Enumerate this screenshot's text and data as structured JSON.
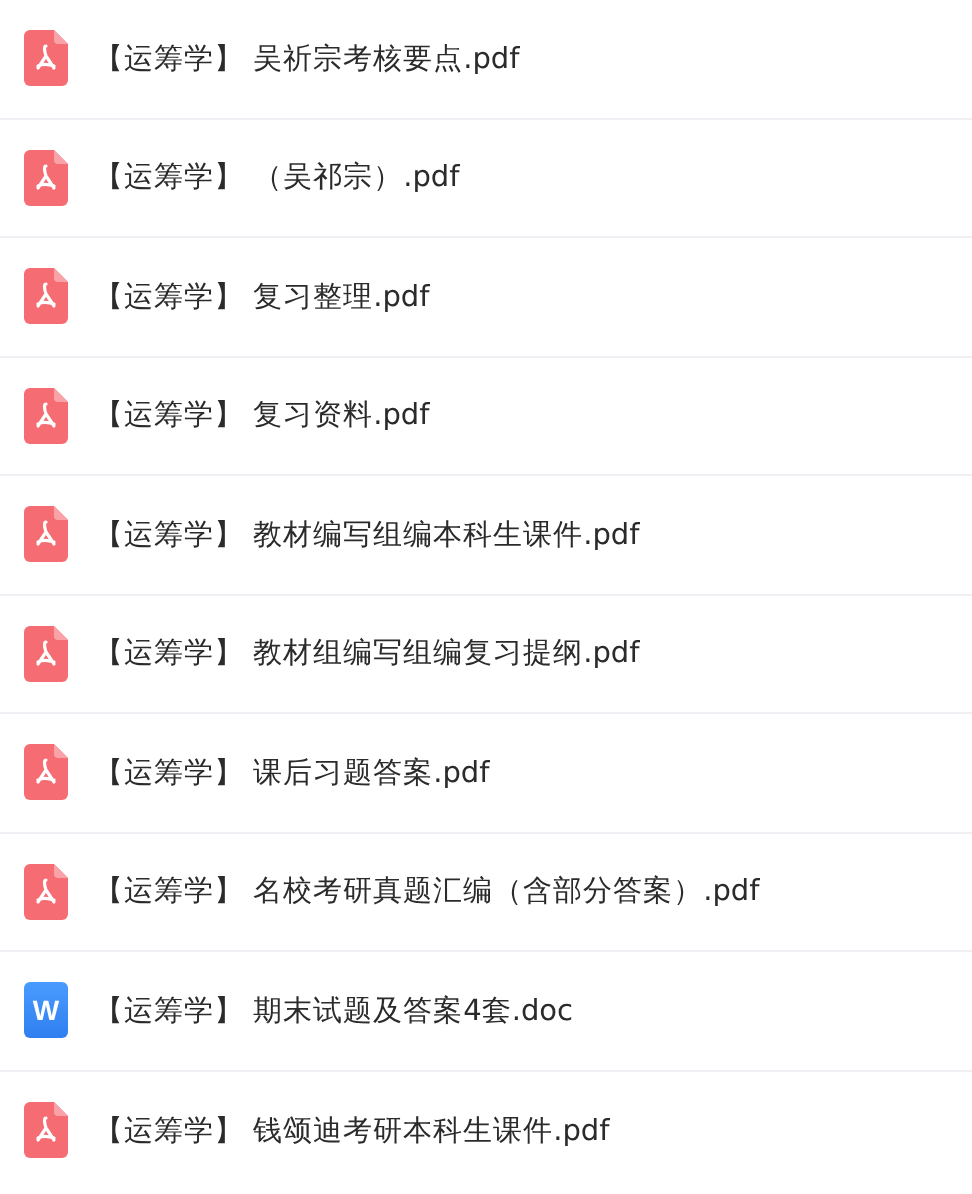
{
  "files": [
    {
      "kind": "pdf",
      "name": "【运筹学】 吴祈宗考核要点.pdf"
    },
    {
      "kind": "pdf",
      "name": "【运筹学】 （吴祁宗）.pdf"
    },
    {
      "kind": "pdf",
      "name": "【运筹学】 复习整理.pdf"
    },
    {
      "kind": "pdf",
      "name": "【运筹学】 复习资料.pdf"
    },
    {
      "kind": "pdf",
      "name": "【运筹学】 教材编写组编本科生课件.pdf"
    },
    {
      "kind": "pdf",
      "name": "【运筹学】 教材组编写组编复习提纲.pdf"
    },
    {
      "kind": "pdf",
      "name": "【运筹学】 课后习题答案.pdf"
    },
    {
      "kind": "pdf",
      "name": "【运筹学】 名校考研真题汇编（含部分答案）.pdf"
    },
    {
      "kind": "doc",
      "badge": "W",
      "name": "【运筹学】 期末试题及答案4套.doc"
    },
    {
      "kind": "pdf",
      "name": "【运筹学】 钱颂迪考研本科生课件.pdf"
    }
  ]
}
